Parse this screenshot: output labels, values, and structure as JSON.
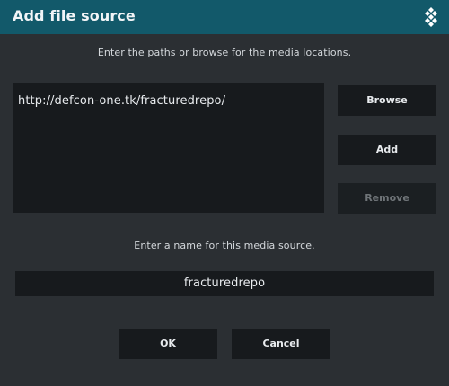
{
  "dialog": {
    "title": "Add file source",
    "logo_icon": "kodi-logo-icon",
    "paths_instruction": "Enter the paths or browse for the media locations.",
    "paths": [
      "http://defcon-one.tk/fracturedrepo/"
    ],
    "buttons": {
      "browse": "Browse",
      "add": "Add",
      "remove": "Remove",
      "ok": "OK",
      "cancel": "Cancel"
    },
    "name_instruction": "Enter a name for this media source.",
    "name_value": "fracturedrepo"
  },
  "colors": {
    "title_bar": "#12596a",
    "dialog_background": "#2b2f33",
    "field_background": "#171a1d",
    "disabled_text": "#6f7478"
  }
}
